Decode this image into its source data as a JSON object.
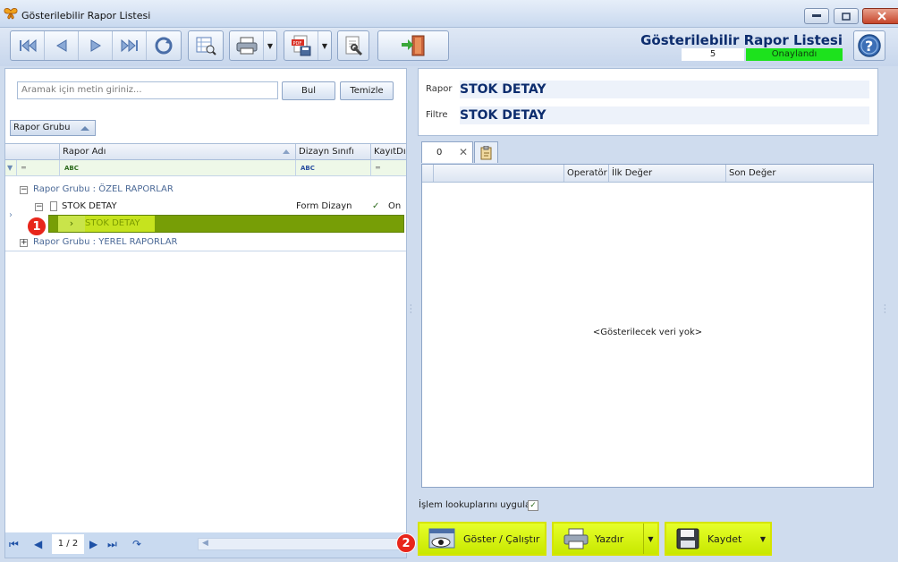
{
  "window": {
    "title": "Gösterilebilir Rapor Listesi",
    "app_icon": "butterfly-icon"
  },
  "toolbar": {
    "first_icon": "first-record-icon",
    "prev_icon": "previous-record-icon",
    "next_icon": "next-record-icon",
    "last_icon": "last-record-icon",
    "refresh_icon": "refresh-icon",
    "grid_icon": "grid-search-icon",
    "print_icon": "printer-icon",
    "pdf_icon": "pdf-save-icon",
    "properties_icon": "document-settings-icon",
    "exit_icon": "exit-door-icon"
  },
  "header": {
    "title": "Gösterilebilir Rapor Listesi",
    "count": "5",
    "status": "Onaylandı",
    "status_color": "#1de21d"
  },
  "search": {
    "placeholder": "Aramak için metin giriniz...",
    "find_label": "Bul",
    "clear_label": "Temizle"
  },
  "grouping": {
    "group_label": "Rapor Grubu"
  },
  "grid": {
    "columns": [
      "Rapor Adı",
      "Dizayn Sınıfı",
      "KayıtDı"
    ],
    "groups": [
      {
        "label": "Rapor Grubu : ÖZEL RAPORLAR"
      },
      {
        "label": "Rapor Grubu : YEREL RAPORLAR"
      }
    ],
    "rows": [
      {
        "name": "STOK DETAY",
        "design": "Form Dizayn",
        "record": "On"
      }
    ],
    "selected": {
      "name": "STOK DETAY"
    }
  },
  "pager": {
    "page": "1 / 2"
  },
  "detail": {
    "report_label": "Rapor",
    "report_value": "STOK DETAY",
    "filter_label": "Filtre",
    "filter_value": "STOK DETAY"
  },
  "criteria": {
    "tab_label": "0",
    "columns": [
      "Operatör",
      "İlk Değer",
      "Son Değer"
    ],
    "empty_text": "<Gösterilecek veri yok>"
  },
  "options": {
    "lookup_label": "İşlem lookuplarını uygula",
    "lookup_checked": true
  },
  "actions": {
    "show_label": "Göster / Çalıştır",
    "print_label": "Yazdır",
    "save_label": "Kaydet",
    "accent_color": "#d5e400"
  },
  "annotations": {
    "badge1": "1",
    "badge2": "2"
  }
}
